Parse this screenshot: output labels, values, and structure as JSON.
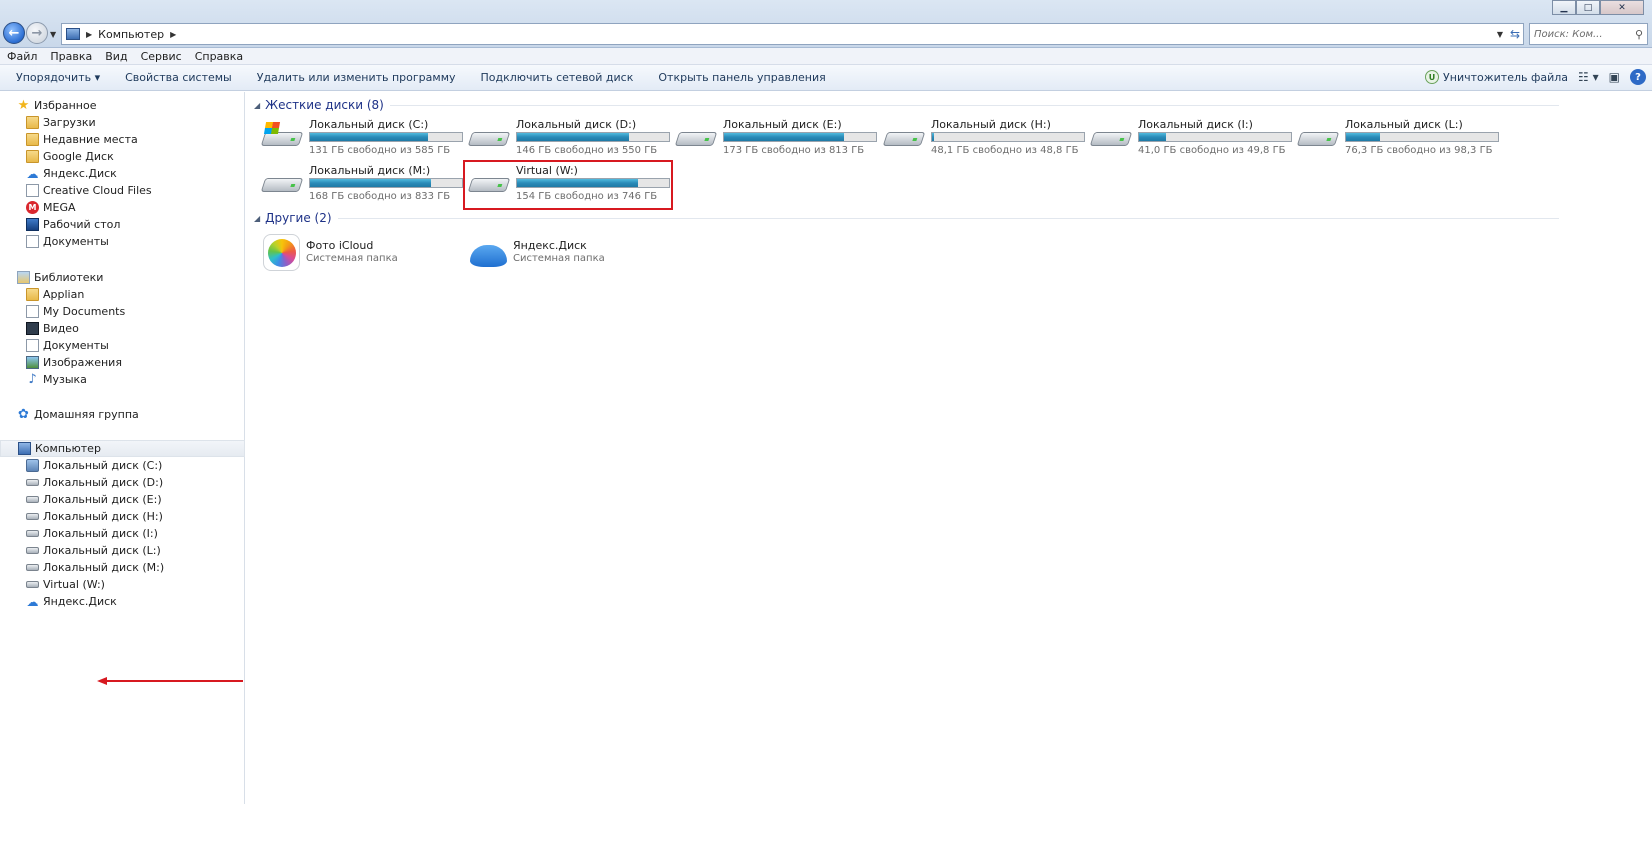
{
  "window": {
    "breadcrumb": [
      "Компьютер"
    ],
    "search_placeholder": "Поиск: Ком...",
    "controls": [
      "minimize",
      "maximize",
      "close"
    ]
  },
  "menu": [
    "Файл",
    "Правка",
    "Вид",
    "Сервис",
    "Справка"
  ],
  "toolbar": {
    "items": [
      "Упорядочить ▾",
      "Свойства системы",
      "Удалить или изменить программу",
      "Подключить сетевой диск",
      "Открыть панель управления"
    ],
    "uninstaller_label": "Уничтожитель файла",
    "uninstaller_icon_letter": "U"
  },
  "nav": {
    "favorites": {
      "title": "Избранное",
      "items": [
        "Загрузки",
        "Недавние места",
        "Google Диск",
        "Яндекс.Диск",
        "Creative Cloud Files",
        "MEGA",
        "Рабочий стол",
        "Документы"
      ]
    },
    "libraries": {
      "title": "Библиотеки",
      "items": [
        "Applian",
        "My Documents",
        "Видео",
        "Документы",
        "Изображения",
        "Музыка"
      ]
    },
    "homegroup": {
      "title": "Домашняя группа"
    },
    "computer": {
      "title": "Компьютер",
      "items": [
        "Локальный диск  (C:)",
        "Локальный диск (D:)",
        "Локальный диск (E:)",
        "Локальный диск (H:)",
        "Локальный диск (I:)",
        "Локальный диск (L:)",
        "Локальный диск (M:)",
        "Virtual (W:)",
        "Яндекс.Диск"
      ]
    }
  },
  "content": {
    "hard_drives_header": "Жесткие диски (8)",
    "other_header": "Другие (2)",
    "drives": [
      {
        "name": "Локальный диск  (C:)",
        "free": "131 ГБ свободно из 585 ГБ",
        "used_fraction": 0.776,
        "system": true
      },
      {
        "name": "Локальный диск (D:)",
        "free": "146 ГБ свободно из 550 ГБ",
        "used_fraction": 0.735
      },
      {
        "name": "Локальный диск (E:)",
        "free": "173 ГБ свободно из 813 ГБ",
        "used_fraction": 0.787
      },
      {
        "name": "Локальный диск (H:)",
        "free": "48,1 ГБ свободно из 48,8 ГБ",
        "used_fraction": 0.014
      },
      {
        "name": "Локальный диск (I:)",
        "free": "41,0 ГБ свободно из 49,8 ГБ",
        "used_fraction": 0.177
      },
      {
        "name": "Локальный диск (L:)",
        "free": "76,3 ГБ свободно из 98,3 ГБ",
        "used_fraction": 0.224
      },
      {
        "name": "Локальный диск (M:)",
        "free": "168 ГБ свободно из 833 ГБ",
        "used_fraction": 0.798
      },
      {
        "name": "Virtual (W:)",
        "free": "154 ГБ свободно из 746 ГБ",
        "used_fraction": 0.794,
        "highlighted": true
      }
    ],
    "others": [
      {
        "name": "Фото iCloud",
        "type": "Системная папка"
      },
      {
        "name": "Яндекс.Диск",
        "type": "Системная папка"
      }
    ]
  },
  "colors": {
    "highlight": "#d71920",
    "bar_fill": "#2a8bb8",
    "group_header": "#1e3287"
  }
}
